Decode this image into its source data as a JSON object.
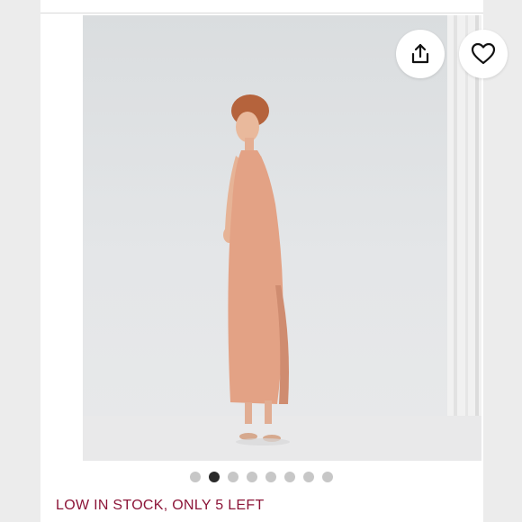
{
  "listing": {
    "stock_notice": "LOW IN STOCK, ONLY 5 LEFT",
    "accent_color": "#8c1538"
  },
  "actions": {
    "share_icon": "share-icon",
    "like_icon": "heart-icon"
  },
  "carousel": {
    "total_images": 8,
    "active_index": 1
  }
}
